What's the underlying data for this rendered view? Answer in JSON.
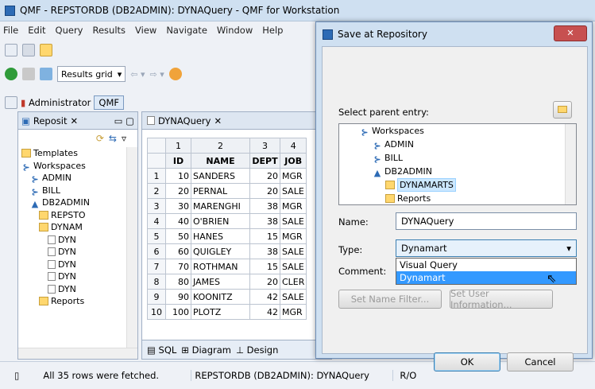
{
  "window": {
    "title": "QMF - REPSTORDB (DB2ADMIN): DYNAQuery - QMF for Workstation"
  },
  "menu": [
    "File",
    "Edit",
    "Query",
    "Results",
    "View",
    "Navigate",
    "Window",
    "Help"
  ],
  "toolbar": {
    "results_mode": "Results grid"
  },
  "perspective": {
    "user": "Administrator",
    "qmf": "QMF"
  },
  "left": {
    "tab": "Reposit",
    "tree": [
      {
        "label": "Templates",
        "icon": "folder",
        "indent": 0
      },
      {
        "label": "Workspaces",
        "icon": "workspace",
        "indent": 0
      },
      {
        "label": "ADMIN",
        "icon": "workspace",
        "indent": 1
      },
      {
        "label": "BILL",
        "icon": "workspace",
        "indent": 1
      },
      {
        "label": "DB2ADMIN",
        "icon": "user",
        "indent": 1
      },
      {
        "label": "REPSTO",
        "icon": "db",
        "indent": 2
      },
      {
        "label": "DYNAM",
        "icon": "folder",
        "indent": 2
      },
      {
        "label": "DYN",
        "icon": "sql",
        "indent": 3
      },
      {
        "label": "DYN",
        "icon": "query",
        "indent": 3
      },
      {
        "label": "DYN",
        "icon": "doc",
        "indent": 3
      },
      {
        "label": "DYN",
        "icon": "doc",
        "indent": 3
      },
      {
        "label": "DYN",
        "icon": "doc",
        "indent": 3
      },
      {
        "label": "Reports",
        "icon": "folder",
        "indent": 2
      }
    ]
  },
  "editor": {
    "tab": "DYNAQuery",
    "col_numbers": [
      "1",
      "2",
      "3",
      "4"
    ],
    "headers": [
      "ID",
      "NAME",
      "DEPT",
      "JOB"
    ],
    "rows": [
      [
        "1",
        "10",
        "SANDERS",
        "20",
        "MGR"
      ],
      [
        "2",
        "20",
        "PERNAL",
        "20",
        "SALE"
      ],
      [
        "3",
        "30",
        "MARENGHI",
        "38",
        "MGR"
      ],
      [
        "4",
        "40",
        "O'BRIEN",
        "38",
        "SALE"
      ],
      [
        "5",
        "50",
        "HANES",
        "15",
        "MGR"
      ],
      [
        "6",
        "60",
        "QUIGLEY",
        "38",
        "SALE"
      ],
      [
        "7",
        "70",
        "ROTHMAN",
        "15",
        "SALE"
      ],
      [
        "8",
        "80",
        "JAMES",
        "20",
        "CLER"
      ],
      [
        "9",
        "90",
        "KOONITZ",
        "42",
        "SALE"
      ],
      [
        "10",
        "100",
        "PLOTZ",
        "42",
        "MGR"
      ]
    ],
    "bottom_tabs": [
      "SQL",
      "Diagram",
      "Design"
    ]
  },
  "status": {
    "left": "All 35 rows were fetched.",
    "middle": "REPSTORDB (DB2ADMIN): DYNAQuery",
    "right": "R/O"
  },
  "dialog": {
    "title": "Save at Repository",
    "select_label": "Select parent entry:",
    "tree": [
      {
        "label": "Workspaces",
        "indent": 0,
        "icon": "workspace"
      },
      {
        "label": "ADMIN",
        "indent": 1,
        "icon": "workspace"
      },
      {
        "label": "BILL",
        "indent": 1,
        "icon": "workspace"
      },
      {
        "label": "DB2ADMIN",
        "indent": 1,
        "icon": "user"
      },
      {
        "label": "DYNAMARTS",
        "indent": 2,
        "icon": "folder",
        "selected": true
      },
      {
        "label": "Reports",
        "indent": 2,
        "icon": "folder"
      }
    ],
    "name_label": "Name:",
    "name_value": "DYNAQuery",
    "type_label": "Type:",
    "type_value": "Dynamart",
    "comment_label": "Comment:",
    "type_options": [
      "Visual Query",
      "Dynamart"
    ],
    "set_name_filter": "Set Name Filter...",
    "set_user_info": "Set User Information...",
    "ok": "OK",
    "cancel": "Cancel"
  }
}
